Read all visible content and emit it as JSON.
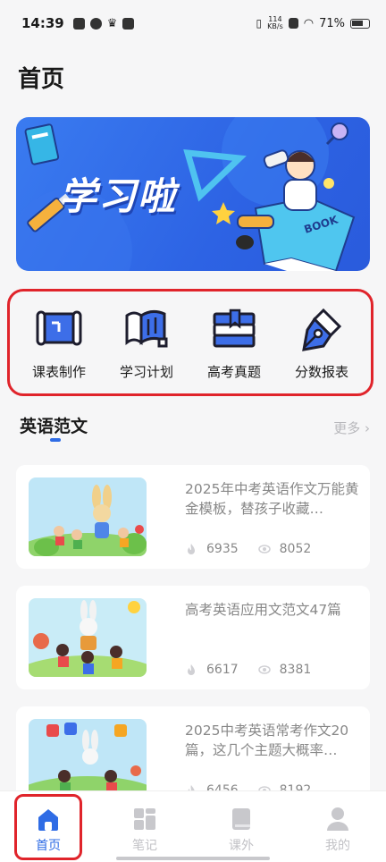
{
  "status_bar": {
    "time": "14:39",
    "speed_value": "114",
    "speed_unit": "KB/s",
    "battery": "71%"
  },
  "page_title": "首页",
  "banner": {
    "title": "学习啦",
    "book_label": "BOOK"
  },
  "functions": [
    {
      "label": "课表制作",
      "icon": "schedule-scroll-icon"
    },
    {
      "label": "学习计划",
      "icon": "study-plan-map-icon"
    },
    {
      "label": "高考真题",
      "icon": "exam-books-icon"
    },
    {
      "label": "分数报表",
      "icon": "fountain-pen-icon"
    }
  ],
  "section": {
    "title": "英语范文",
    "more": "更多 ›"
  },
  "articles": [
    {
      "title": "2025年中考英语作文万能黄金模板，替孩子收藏…",
      "likes": "6935",
      "views": "8052"
    },
    {
      "title": "高考英语应用文范文47篇",
      "likes": "6617",
      "views": "8381"
    },
    {
      "title": "2025中考英语常考作文20篇，这几个主题大概率…",
      "likes": "6456",
      "views": "8192"
    }
  ],
  "tabs": [
    {
      "label": "首页",
      "active": true
    },
    {
      "label": "笔记",
      "active": false
    },
    {
      "label": "课外",
      "active": false
    },
    {
      "label": "我的",
      "active": false
    }
  ],
  "colors": {
    "accent": "#2f6ce5",
    "highlight": "#e0242b",
    "banner": "#2d63e4"
  }
}
